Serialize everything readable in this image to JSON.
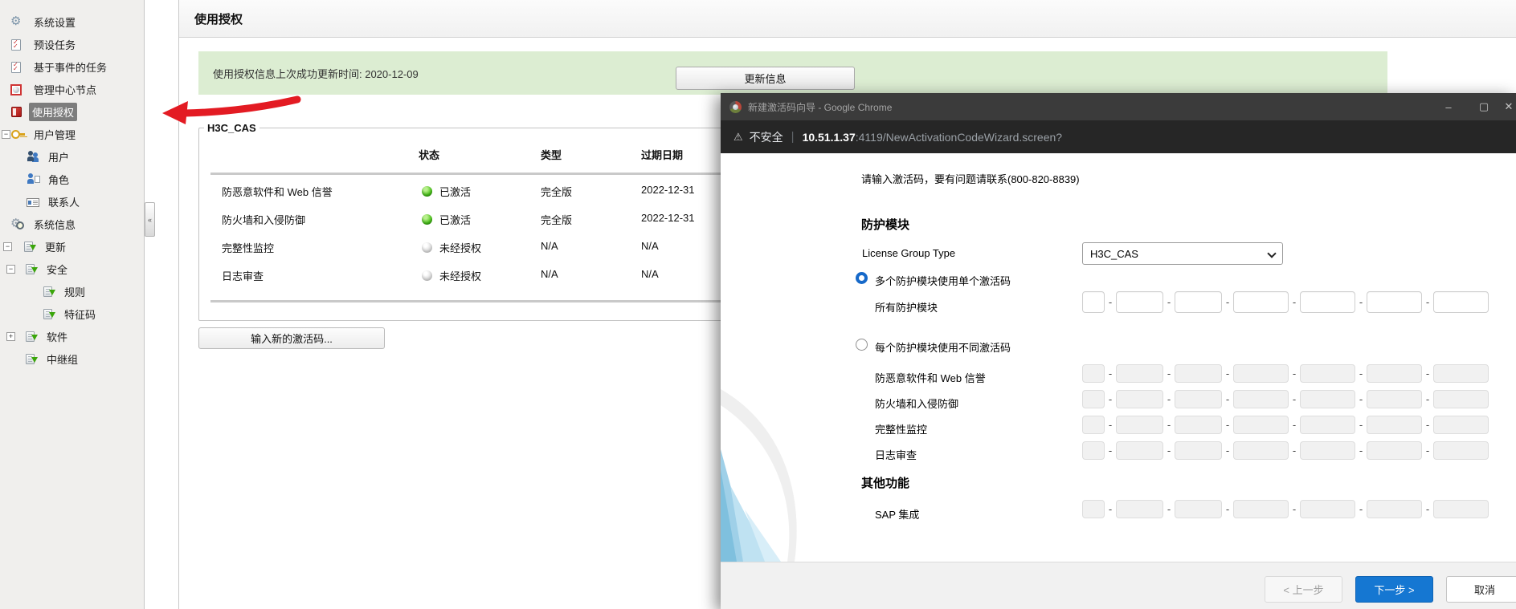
{
  "sidebar": {
    "items": [
      {
        "icon": "gear-icon",
        "label": "系统设置"
      },
      {
        "icon": "task-list-icon",
        "label": "预设任务"
      },
      {
        "icon": "task-list-icon",
        "label": "基于事件的任务"
      },
      {
        "icon": "management-node-icon",
        "label": "管理中心节点"
      },
      {
        "icon": "license-icon",
        "label": "使用授权",
        "selected": true
      },
      {
        "icon": "user-key-icon",
        "label": "用户管理",
        "expanded": true
      },
      {
        "icon": "users-icon",
        "label": "用户"
      },
      {
        "icon": "role-icon",
        "label": "角色"
      },
      {
        "icon": "contact-card-icon",
        "label": "联系人"
      },
      {
        "icon": "system-info-icon",
        "label": "系统信息"
      },
      {
        "icon": "update-icon",
        "label": "更新",
        "expanded": true
      },
      {
        "icon": "update-icon",
        "label": "安全",
        "expanded": true
      },
      {
        "icon": "update-icon",
        "label": "规则"
      },
      {
        "icon": "update-icon",
        "label": "特征码"
      },
      {
        "icon": "update-icon",
        "label": "软件",
        "collapsed": true
      },
      {
        "icon": "update-icon",
        "label": "中继组"
      }
    ],
    "expand_minus": "−",
    "expand_plus": "+",
    "collapse_glyph": "«"
  },
  "main": {
    "title": "使用授权",
    "info_bar": "使用授权信息上次成功更新时间: 2020-12-09",
    "update_button": "更新信息",
    "fieldset_title": "H3C_CAS",
    "table": {
      "headers": {
        "status": "状态",
        "type": "类型",
        "expiry": "过期日期"
      },
      "rows": [
        {
          "name": "防恶意软件和 Web 信誉",
          "status": "已激活",
          "status_color": "#4fc41d",
          "type": "完全版",
          "expiry": "2022-12-31"
        },
        {
          "name": "防火墙和入侵防御",
          "status": "已激活",
          "status_color": "#4fc41d",
          "type": "完全版",
          "expiry": "2022-12-31"
        },
        {
          "name": "完整性监控",
          "status": "未经授权",
          "status_color": "#c9c9c9",
          "type": "N/A",
          "expiry": "N/A"
        },
        {
          "name": "日志审查",
          "status": "未经授权",
          "status_color": "#c9c9c9",
          "type": "N/A",
          "expiry": "N/A"
        }
      ]
    },
    "new_code_button": "输入新的激活码..."
  },
  "chrome": {
    "window_title": "新建激活码向导 - Google Chrome",
    "controls": {
      "minimize": "–",
      "maximize": "▢",
      "close": "✕"
    },
    "warning_glyph": "⚠",
    "security_label": "不安全",
    "url_divider": "|",
    "url_host": "10.51.1.37",
    "url_path": ":4119/NewActivationCodeWizard.screen?",
    "wizard": {
      "intro": "请输入激活码，要有问题请联系(800-820-8839)",
      "section_modules": "防护模块",
      "license_group_label": "License Group Type",
      "license_group_value": "H3C_CAS",
      "radio_single": "多个防护模块使用单个激活码",
      "all_modules_label": "所有防护模块",
      "radio_multi": "每个防护模块使用不同激活码",
      "module_rows": [
        {
          "label": "防恶意软件和 Web 信誉"
        },
        {
          "label": "防火墙和入侵防御"
        },
        {
          "label": "完整性监控"
        },
        {
          "label": "日志审查"
        }
      ],
      "section_other": "其他功能",
      "sap_label": "SAP 集成",
      "code_value": "",
      "back_button": "< 上一步",
      "next_button": "下一步 >",
      "cancel_button": "取消",
      "accent_color": "#1577d2"
    }
  }
}
